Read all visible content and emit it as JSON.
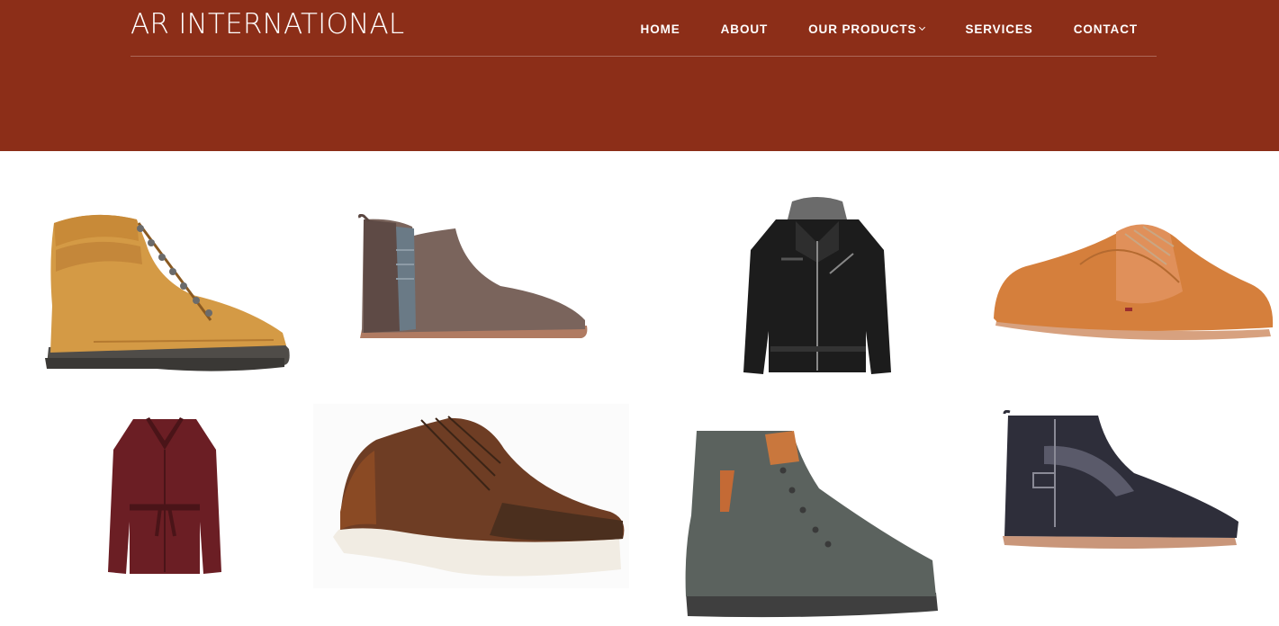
{
  "header": {
    "brand": "AR INTERNATIONAL",
    "nav": [
      {
        "label": "HOME"
      },
      {
        "label": "ABOUT"
      },
      {
        "label": "OUR PRODUCTS",
        "has_dropdown": true
      },
      {
        "label": "SERVICES"
      },
      {
        "label": "CONTACT"
      }
    ]
  },
  "colors": {
    "hero_background": "#8c2e18",
    "nav_text": "#ffffff"
  },
  "products": [
    {
      "name": "tan-lace-up-hiking-boot"
    },
    {
      "name": "brown-chelsea-boot"
    },
    {
      "name": "black-leather-hooded-jacket"
    },
    {
      "name": "tan-suede-derby-shoe"
    },
    {
      "name": "burgundy-leather-belted-coat"
    },
    {
      "name": "brown-leather-sneaker"
    },
    {
      "name": "grey-suede-lace-up-boot"
    },
    {
      "name": "navy-buckle-ankle-boot"
    }
  ]
}
